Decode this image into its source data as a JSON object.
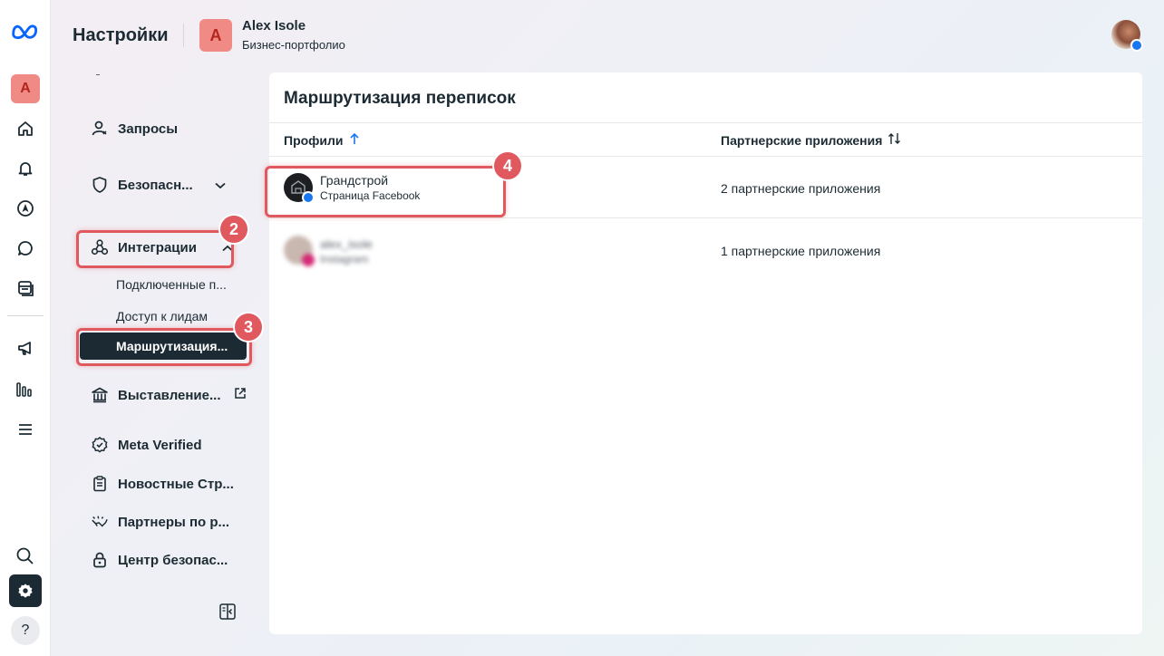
{
  "header": {
    "title": "Настройки",
    "account_initial": "A",
    "account_name": "Alex Isole",
    "account_type": "Бизнес-портфолио"
  },
  "rail": {
    "account_initial": "A",
    "help_glyph": "?"
  },
  "sidebar": {
    "items": [
      {
        "label": "Запросы",
        "icon": "person-request-icon"
      },
      {
        "label": "Безопасн...",
        "icon": "shield-icon"
      },
      {
        "label": "Интеграции",
        "icon": "integrations-icon"
      },
      {
        "label": "Выставление...",
        "icon": "bank-icon"
      },
      {
        "label": "Meta Verified",
        "icon": "verified-badge-icon"
      },
      {
        "label": "Новостные Стр...",
        "icon": "clipboard-icon"
      },
      {
        "label": "Партнеры по р...",
        "icon": "handshake-icon"
      },
      {
        "label": "Центр безопас...",
        "icon": "lock-icon"
      }
    ],
    "integrations_sub": [
      {
        "label": "Подключенные п..."
      },
      {
        "label": "Доступ к лидам"
      },
      {
        "label": "Маршрутизация..."
      }
    ],
    "callouts": [
      "2",
      "3"
    ]
  },
  "main": {
    "title": "Маршрутизация переписок",
    "columns": [
      "Профили",
      "Партнерские приложения"
    ],
    "rows": [
      {
        "name": "Грандстрой",
        "type": "Страница Facebook",
        "apps": "2 партнерские приложения"
      },
      {
        "name": "alex_isole",
        "type": "Instagram",
        "apps": "1 партнерские приложения"
      }
    ],
    "callout": "4"
  },
  "colors": {
    "highlight": "#e0595f",
    "dark": "#1c2b33",
    "facebook": "#1877f2",
    "avatar_bg": "#f08a85"
  }
}
